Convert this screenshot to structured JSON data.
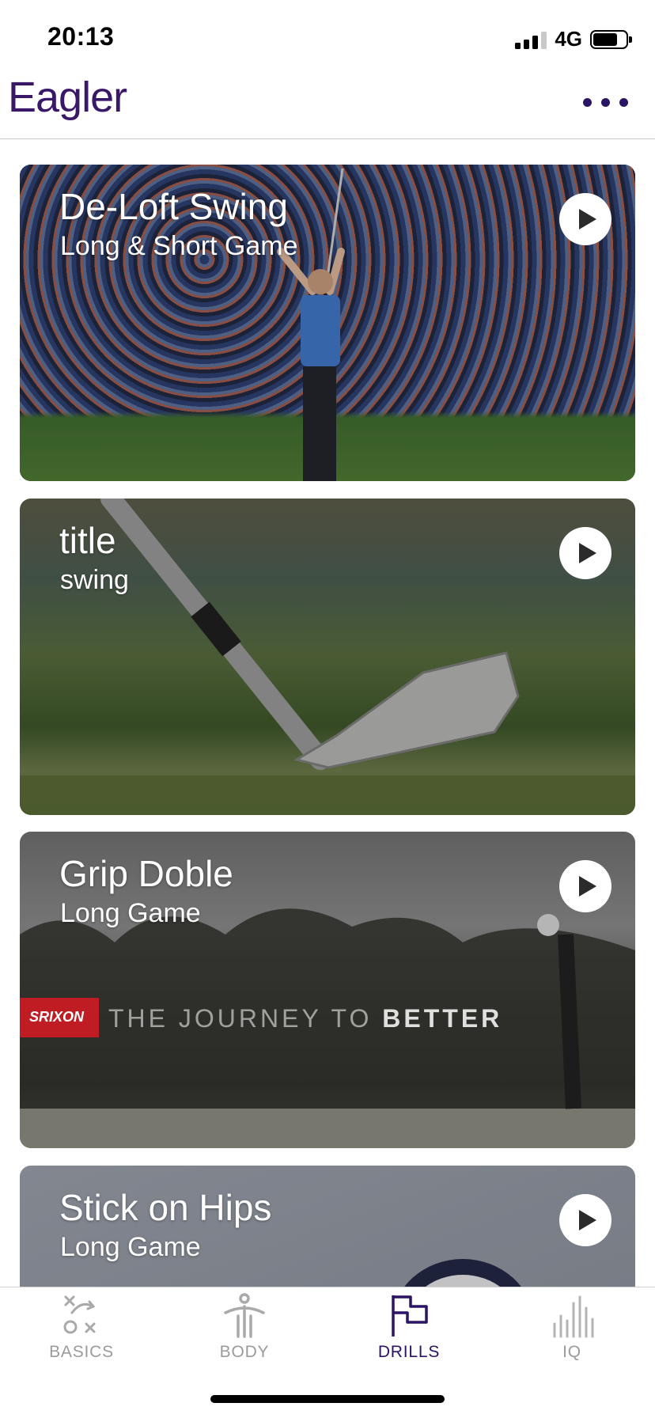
{
  "status_bar": {
    "time": "20:13",
    "network": "4G"
  },
  "header": {
    "logo": "Eagler"
  },
  "drills": [
    {
      "title": "De-Loft Swing",
      "subtitle": "Long & Short Game"
    },
    {
      "title": "title",
      "subtitle": "swing"
    },
    {
      "title": "Grip Doble",
      "subtitle": "Long Game",
      "banner_brand": "SRIXON",
      "banner_text": "THE JOURNEY TO",
      "banner_bold": "BETTER"
    },
    {
      "title": "Stick on Hips",
      "subtitle": "Long Game"
    }
  ],
  "tabs": [
    {
      "label": "BASICS",
      "icon": "basics-icon"
    },
    {
      "label": "BODY",
      "icon": "body-icon"
    },
    {
      "label": "DRILLS",
      "icon": "drills-flag-icon",
      "active": true
    },
    {
      "label": "IQ",
      "icon": "iq-bars-icon"
    }
  ],
  "colors": {
    "brand": "#3a1868",
    "active_tab": "#2b1466",
    "inactive_tab": "#9b9b9b"
  }
}
